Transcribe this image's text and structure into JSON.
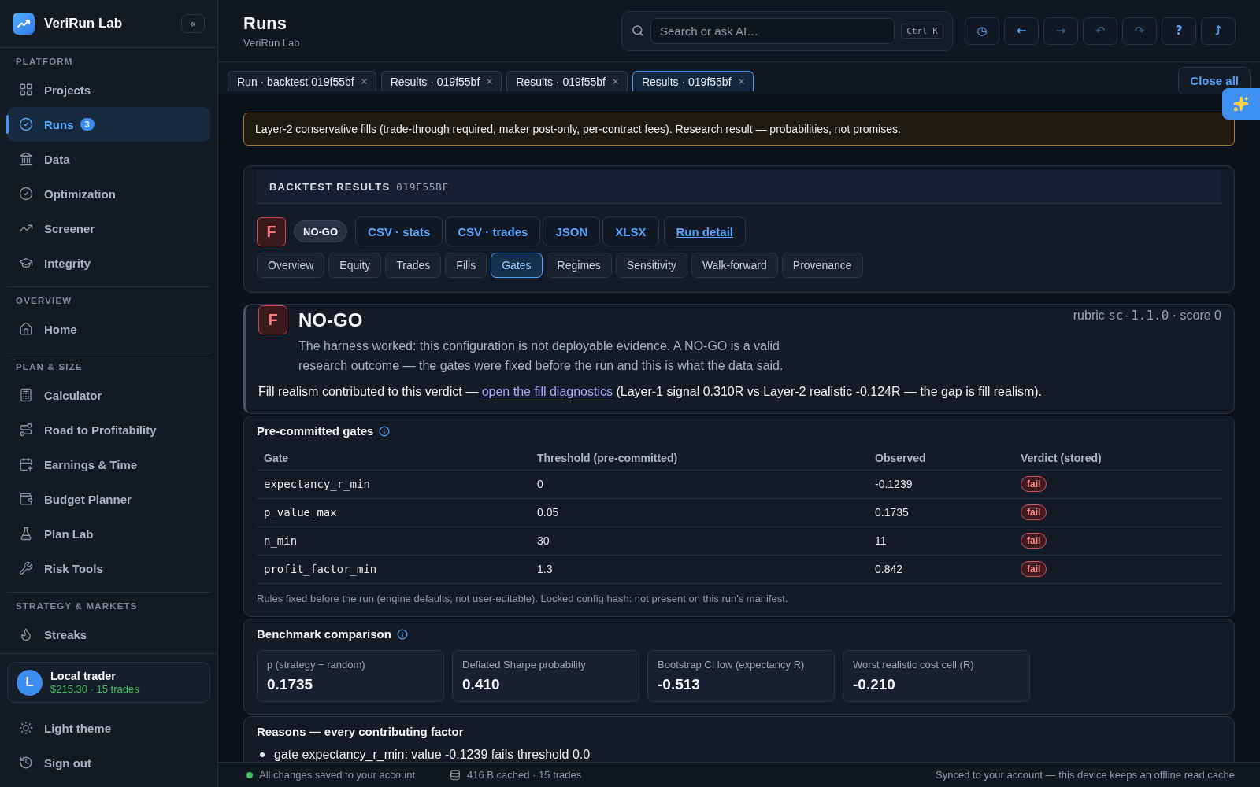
{
  "sidebar": {
    "brand": "VeriRun Lab",
    "collapse_button": "«",
    "sections": [
      {
        "title": "PLATFORM",
        "items": [
          {
            "label": "Projects",
            "selected": false
          },
          {
            "label": "Runs",
            "selected": true,
            "badge": "3"
          },
          {
            "label": "Data",
            "selected": false
          },
          {
            "label": "Optimization",
            "selected": false
          },
          {
            "label": "Screener",
            "selected": false
          },
          {
            "label": "Integrity",
            "selected": false
          }
        ]
      },
      {
        "title": "OVERVIEW",
        "items": [
          {
            "label": "Home",
            "selected": false
          }
        ]
      },
      {
        "title": "PLAN & SIZE",
        "items": [
          {
            "label": "Calculator",
            "selected": false
          },
          {
            "label": "Road to Profitability",
            "selected": false
          },
          {
            "label": "Earnings & Time",
            "selected": false
          },
          {
            "label": "Budget Planner",
            "selected": false
          },
          {
            "label": "Plan Lab",
            "selected": false
          },
          {
            "label": "Risk Tools",
            "selected": false
          }
        ]
      },
      {
        "title": "STRATEGY & MARKETS",
        "items": [
          {
            "label": "Streaks",
            "selected": false
          }
        ]
      }
    ],
    "user": {
      "initial": "L",
      "name": "Local trader",
      "summary": "$215.30 · 15 trades"
    },
    "actions": [
      {
        "label": "Light theme"
      },
      {
        "label": "Sign out"
      }
    ]
  },
  "header": {
    "title": "Runs",
    "subtitle": "VeriRun Lab",
    "search": {
      "placeholder": "Search or ask AI…",
      "shortcut": "Ctrl K"
    },
    "toolbar": [
      {
        "glyph": "◷",
        "disabled": false
      },
      {
        "glyph": "←",
        "disabled": false
      },
      {
        "glyph": "→",
        "disabled": true
      },
      {
        "glyph": "↶",
        "disabled": true
      },
      {
        "glyph": "↷",
        "disabled": true
      },
      {
        "glyph": "?",
        "disabled": false
      },
      {
        "glyph": "⤴",
        "disabled": false
      }
    ]
  },
  "tabs": [
    {
      "label": "Run · backtest 019f55bf",
      "selected": false
    },
    {
      "label": "Results · 019f55bf",
      "selected": false
    },
    {
      "label": "Results · 019f55bf",
      "selected": false
    },
    {
      "label": "Results · 019f55bf",
      "selected": true
    }
  ],
  "close_all": "Close all",
  "notice": "Layer-2 conservative fills (trade-through required, maker post-only, per-contract fees). Research result — probabilities, not promises.",
  "results": {
    "heading": "BACKTEST RESULTS",
    "run_id": "019F55BF",
    "grade": "F",
    "verdict": "NO-GO",
    "actions": [
      {
        "label": "CSV · stats",
        "kind": "export"
      },
      {
        "label": "CSV · trades",
        "kind": "export"
      },
      {
        "label": "JSON",
        "kind": "export"
      },
      {
        "label": "XLSX",
        "kind": "export"
      },
      {
        "label": "Run detail",
        "kind": "link"
      }
    ],
    "tabs": [
      {
        "label": "Overview",
        "selected": false
      },
      {
        "label": "Equity",
        "selected": false
      },
      {
        "label": "Trades",
        "selected": false
      },
      {
        "label": "Fills",
        "selected": false
      },
      {
        "label": "Gates",
        "selected": true
      },
      {
        "label": "Regimes",
        "selected": false
      },
      {
        "label": "Sensitivity",
        "selected": false
      },
      {
        "label": "Walk-forward",
        "selected": false
      },
      {
        "label": "Provenance",
        "selected": false
      }
    ]
  },
  "verdict_panel": {
    "grade": "F",
    "title": "NO-GO",
    "rubric": {
      "label": "rubric",
      "id": "sc-1.1.0",
      "score": "· score 0"
    },
    "description": "The harness worked: this configuration is not deployable evidence. A NO-GO is a valid research outcome — the gates were fixed before the run and this is what the data said.",
    "note": {
      "before": "Fill realism contributed to this verdict —",
      "link": "open the fill diagnostics",
      "after": "(Layer-1 signal 0.310R vs Layer-2 realistic -0.124R — the gap is fill realism)."
    }
  },
  "gates": {
    "title": "Pre-committed gates",
    "columns": [
      "Gate",
      "Threshold (pre-committed)",
      "Observed",
      "Verdict (stored)"
    ],
    "rows": [
      {
        "gate": "expectancy_r_min",
        "threshold": "0",
        "observed": "-0.1239",
        "verdict": "fail",
        "passed": false
      },
      {
        "gate": "p_value_max",
        "threshold": "0.05",
        "observed": "0.1735",
        "verdict": "fail",
        "passed": false
      },
      {
        "gate": "n_min",
        "threshold": "30",
        "observed": "11",
        "verdict": "fail",
        "passed": false
      },
      {
        "gate": "profit_factor_min",
        "threshold": "1.3",
        "observed": "0.842",
        "verdict": "fail",
        "passed": false
      }
    ],
    "footnote": "Rules fixed before the run (engine defaults; not user-editable). Locked config hash: not present on this run's manifest."
  },
  "benchmark": {
    "title": "Benchmark comparison",
    "stats": [
      {
        "label": "p (strategy − random)",
        "value": "0.1735"
      },
      {
        "label": "Deflated Sharpe probability",
        "value": "0.410"
      },
      {
        "label": "Bootstrap CI low (expectancy R)",
        "value": "-0.513"
      },
      {
        "label": "Worst realistic cost cell (R)",
        "value": "-0.210"
      }
    ]
  },
  "reasons": {
    "title": "Reasons — every contributing factor",
    "items": [
      "gate expectancy_r_min: value -0.1239 fails threshold 0.0"
    ]
  },
  "status_bar": {
    "saved": "All changes saved to your account",
    "cache": "416 B cached · 15 trades",
    "sync": "Synced to your account — this device keeps an offline read cache"
  }
}
